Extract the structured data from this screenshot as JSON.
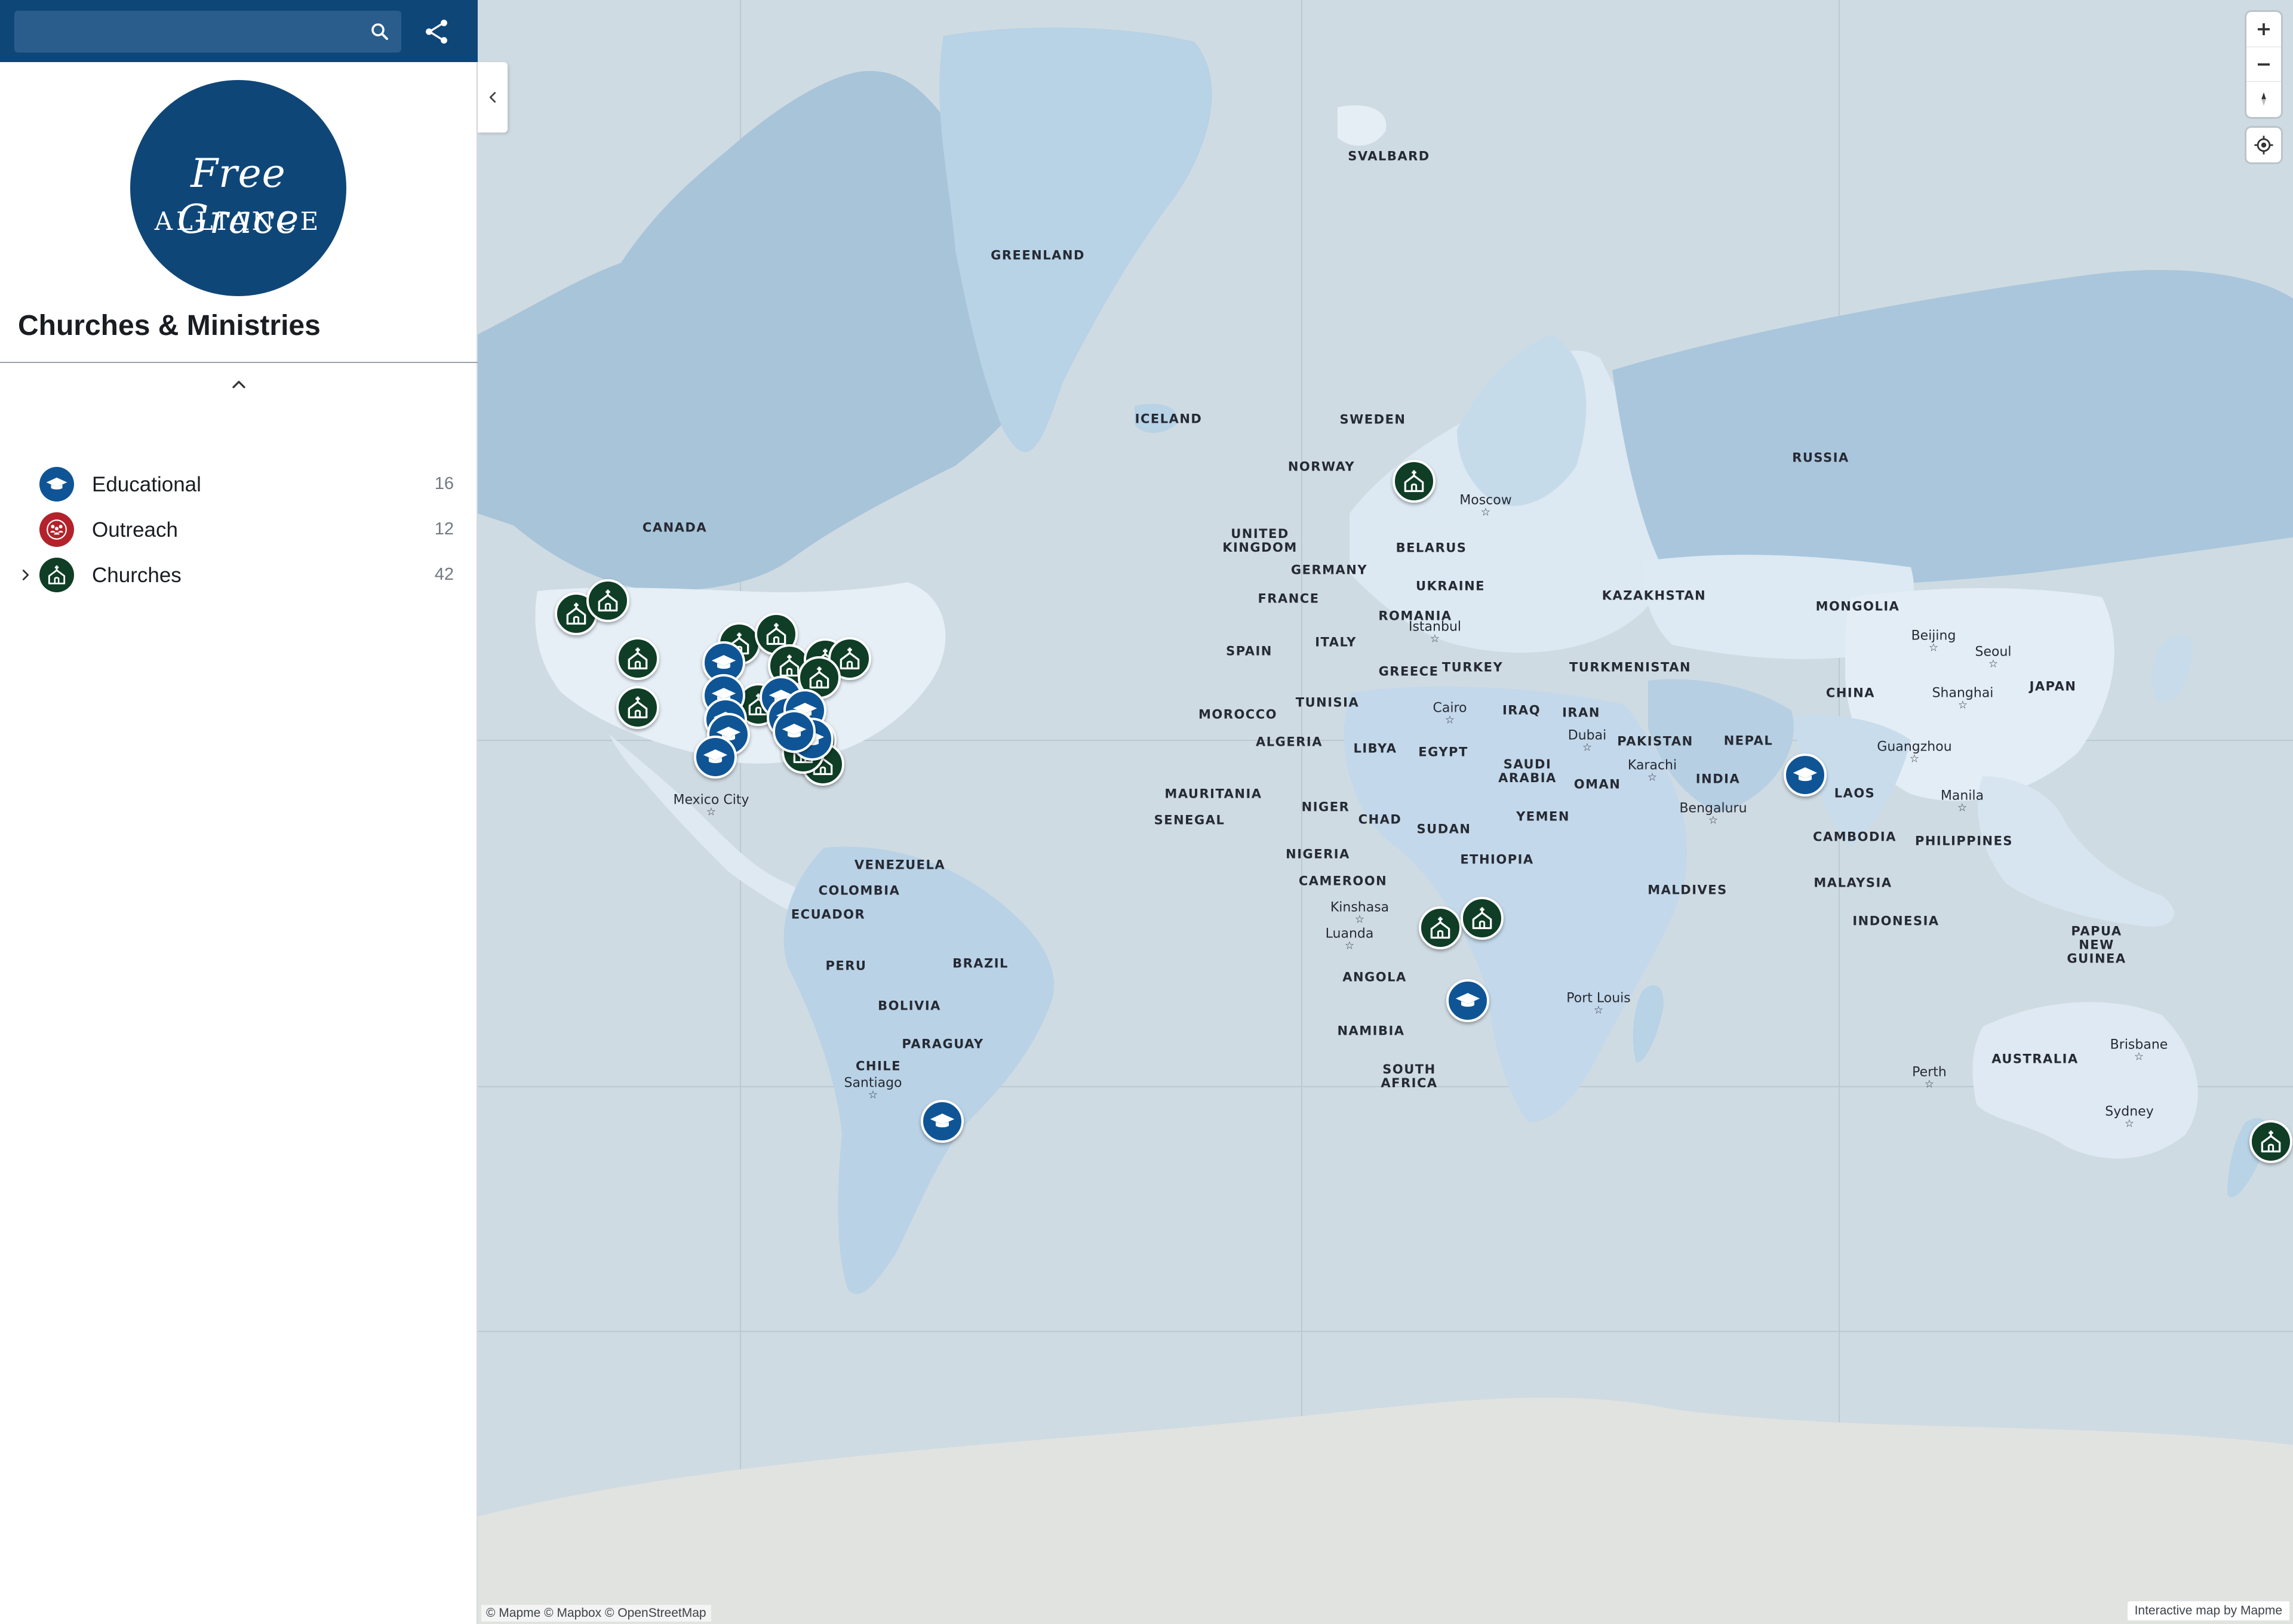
{
  "search": {
    "placeholder": "",
    "value": ""
  },
  "sidebar": {
    "logo_line1": "Free Grace",
    "logo_line2": "ALLIANCE",
    "title": "Churches & Ministries",
    "categories": [
      {
        "label": "Educational",
        "count": "16",
        "icon": "graduation-cap-icon",
        "color": "#0f5596"
      },
      {
        "label": "Outreach",
        "count": "12",
        "icon": "people-group-icon",
        "color": "#b3222a"
      },
      {
        "label": "Churches",
        "count": "42",
        "icon": "church-icon",
        "color": "#0f3d26"
      }
    ]
  },
  "colors": {
    "brand": "#0f4678",
    "church_marker": "#0f3d26",
    "educational_marker": "#0f5596",
    "outreach_marker": "#b3222a"
  },
  "map": {
    "country_labels": [
      "GREENLAND",
      "SVALBARD",
      "ICELAND",
      "SWEDEN",
      "NORWAY",
      "RUSSIA",
      "CANADA",
      "UNITED KINGDOM",
      "BELARUS",
      "GERMANY",
      "UKRAINE",
      "FRANCE",
      "ROMANIA",
      "KAZAKHSTAN",
      "MONGOLIA",
      "SPAIN",
      "ITALY",
      "GREECE",
      "TURKEY",
      "TURKMENISTAN",
      "JAPAN",
      "MOROCCO",
      "TUNISIA",
      "IRAQ",
      "IRAN",
      "CHINA",
      "ALGERIA",
      "LIBYA",
      "EGYPT",
      "PAKISTAN",
      "NEPAL",
      "SAUDI ARABIA",
      "OMAN",
      "INDIA",
      "MAURITANIA",
      "SENEGAL",
      "NIGER",
      "CHAD",
      "SUDAN",
      "YEMEN",
      "LAOS",
      "PHILIPPINES",
      "CAMBODIA",
      "NIGERIA",
      "ETHIOPIA",
      "VENEZUELA",
      "COLOMBIA",
      "ECUADOR",
      "CAMEROON",
      "MALDIVES",
      "MALAYSIA",
      "INDONESIA",
      "PAPUA NEW GUINEA",
      "PERU",
      "BRAZIL",
      "ANGOLA",
      "BOLIVIA",
      "PARAGUAY",
      "NAMIBIA",
      "CHILE",
      "AUSTRALIA",
      "SOUTH AFRICA"
    ],
    "city_labels": [
      "Moscow",
      "Istanbul",
      "Beijing",
      "Seoul",
      "Shanghai",
      "Cairo",
      "Dubai",
      "Karachi",
      "Guangzhou",
      "Bengaluru",
      "Manila",
      "Mexico City",
      "Kinshasa",
      "Luanda",
      "Port Louis",
      "Brisbane",
      "Perth",
      "Santiago",
      "Sydney"
    ],
    "attribution": "© Mapme © Mapbox © OpenStreetMap",
    "credit": "Interactive map by Mapme"
  }
}
